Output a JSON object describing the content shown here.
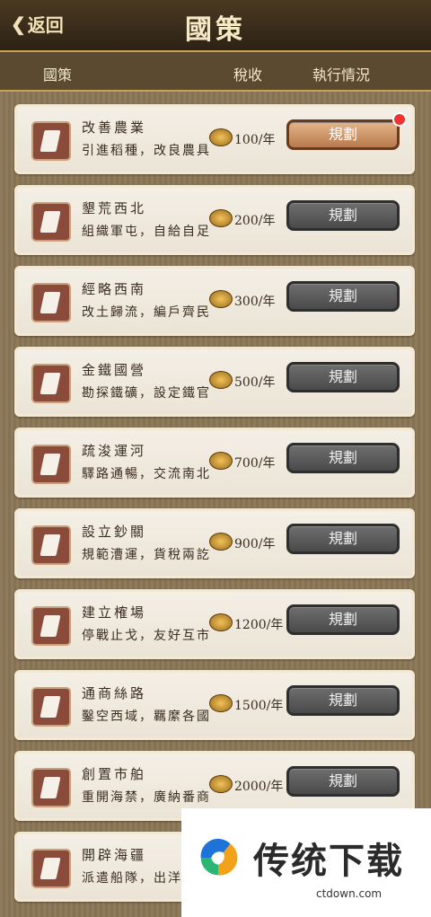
{
  "header": {
    "back_label": "返回",
    "title": "國策"
  },
  "columns": {
    "policy": "國策",
    "tax": "稅收",
    "status": "執行情況"
  },
  "policies": [
    {
      "name": "改善農業",
      "desc": "引進稻種，改良農具",
      "cost": "100/年",
      "button": "規劃",
      "active": true
    },
    {
      "name": "墾荒西北",
      "desc": "組織軍屯，自給自足",
      "cost": "200/年",
      "button": "規劃",
      "active": false
    },
    {
      "name": "經略西南",
      "desc": "改土歸流，編戶齊民",
      "cost": "300/年",
      "button": "規劃",
      "active": false
    },
    {
      "name": "金鐵國營",
      "desc": "勘探鐵礦，設定鐵官",
      "cost": "500/年",
      "button": "規劃",
      "active": false
    },
    {
      "name": "疏浚運河",
      "desc": "驛路通暢，交流南北",
      "cost": "700/年",
      "button": "規劃",
      "active": false
    },
    {
      "name": "設立鈔關",
      "desc": "規範漕運，貨稅兩訖",
      "cost": "900/年",
      "button": "規劃",
      "active": false
    },
    {
      "name": "建立榷場",
      "desc": "停戰止戈，友好互市",
      "cost": "1200/年",
      "button": "規劃",
      "active": false
    },
    {
      "name": "通商絲路",
      "desc": "鑿空西域，羈縻各國",
      "cost": "1500/年",
      "button": "規劃",
      "active": false
    },
    {
      "name": "創置市舶",
      "desc": "重開海禁，廣納番商",
      "cost": "2000/年",
      "button": "規劃",
      "active": false
    },
    {
      "name": "開辟海疆",
      "desc": "派遣船隊，出洋",
      "cost": "",
      "button": "",
      "active": false
    }
  ],
  "watermark": {
    "text": "传统下载",
    "url": "ctdown.com"
  }
}
